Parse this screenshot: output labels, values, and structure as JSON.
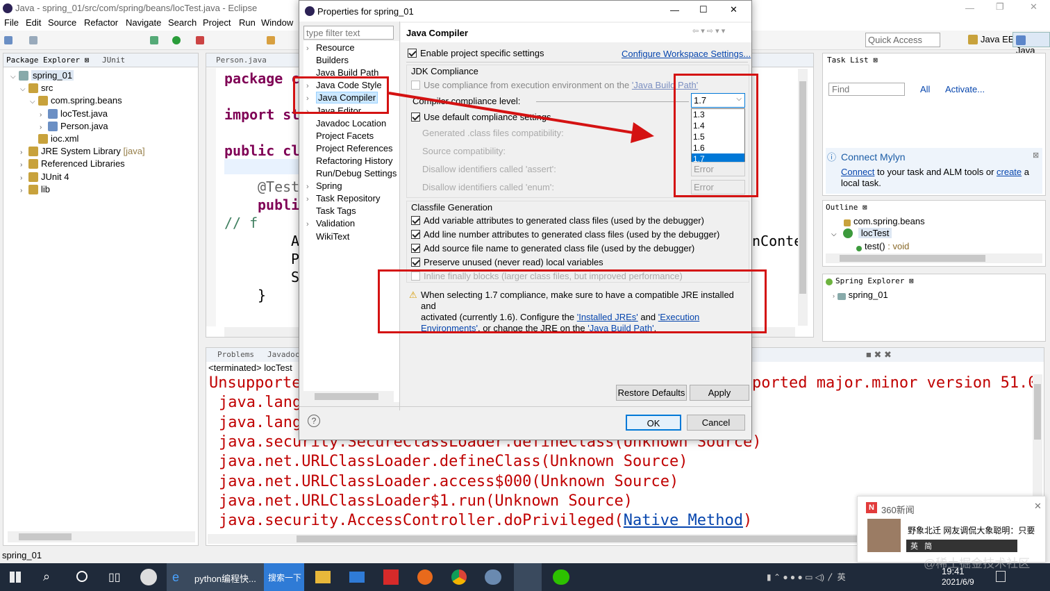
{
  "window_title": "Java - spring_01/src/com/spring/beans/locTest.java - Eclipse",
  "menu": [
    "File",
    "Edit",
    "Source",
    "Refactor",
    "Navigate",
    "Search",
    "Project",
    "Run",
    "Window"
  ],
  "quick_access_placeholder": "Quick Access",
  "perspectives": [
    "Java EE",
    "Java"
  ],
  "package_explorer": {
    "tab": "Package Explorer",
    "tab2": "JUnit",
    "tree": [
      {
        "label": "spring_01",
        "level": 0
      },
      {
        "label": "src",
        "level": 1
      },
      {
        "label": "com.spring.beans",
        "level": 2
      },
      {
        "label": "locTest.java",
        "level": 3
      },
      {
        "label": "Person.java",
        "level": 3
      },
      {
        "label": "ioc.xml",
        "level": 2
      },
      {
        "label": "JRE System Library",
        "suffix": "[java]",
        "level": 1
      },
      {
        "label": "Referenced Libraries",
        "level": 1
      },
      {
        "label": "JUnit 4",
        "level": 1
      },
      {
        "label": "lib",
        "level": 1
      }
    ]
  },
  "editor": {
    "tab": "Person.java",
    "lines": [
      "package c",
      "import st",
      "public cl",
      "@Test",
      "publi",
      "//       f",
      "A",
      "P",
      "S",
      "}"
    ],
    "right_fragment": "nConte"
  },
  "console": {
    "tabs": [
      "Problems",
      "Javadoc"
    ],
    "terminated": "<terminated> locTest",
    "lines": [
      "Unsupporte",
      "java.lang",
      "java.lang",
      "java.security.SecureClassLoader.defineClass(Unknown Source)",
      "java.net.URLClassLoader.defineClass(Unknown Source)",
      "java.net.URLClassLoader.access$000(Unknown Source)",
      "java.net.URLClassLoader$1.run(Unknown Source)"
    ],
    "last_line_prefix": "java.security.AccessController.doPrivileged(",
    "last_line_link": "Native Method",
    "last_line_suffix": ")",
    "right_fragment": "ported major.minor version 51.0"
  },
  "task_list": {
    "tab": "Task List",
    "find_placeholder": "Find",
    "all": "All",
    "activate": "Activate..."
  },
  "mylyn": {
    "title": "Connect Mylyn",
    "link1": "Connect",
    "text1": " to your task and ALM tools or ",
    "link2": "create",
    "text2": " a",
    "text3": "local task."
  },
  "outline": {
    "tab": "Outline",
    "package": "com.spring.beans",
    "class": "locTest",
    "method": "test()",
    "method_type": " : void"
  },
  "spring_explorer": {
    "tab": "Spring Explorer",
    "item": "spring_01"
  },
  "status_bar": "spring_01",
  "dialog": {
    "title": "Properties for spring_01",
    "filter_placeholder": "type filter text",
    "nav": [
      "Resource",
      "Builders",
      "Java Build Path",
      "Java Code Style",
      "Java Compiler",
      "Java Editor",
      "Javadoc Location",
      "Project Facets",
      "Project References",
      "Refactoring History",
      "Run/Debug Settings",
      "Spring",
      "Task Repository",
      "Task Tags",
      "Validation",
      "WikiText"
    ],
    "selected_nav": "Java Compiler",
    "page_title": "Java Compiler",
    "enable_specific": "Enable project specific settings",
    "configure_link": "Configure Workspace Settings...",
    "jdk_group": "JDK Compliance",
    "use_exec_env": "Use compliance from execution environment on the ",
    "java_build_path_link": "'Java Build Path'",
    "compliance_label": "Compiler compliance level:",
    "compliance_value": "1.7",
    "compliance_options": [
      "1.3",
      "1.4",
      "1.5",
      "1.6",
      "1.7"
    ],
    "use_default": "Use default compliance settings",
    "generated_label": "Generated .class files compatibility:",
    "source_label": "Source compatibility:",
    "assert_label": "Disallow identifiers called 'assert':",
    "assert_value": "Error",
    "enum_label": "Disallow identifiers called 'enum':",
    "enum_value": "Error",
    "classfile_group": "Classfile Generation",
    "classfile_opts": [
      "Add variable attributes to generated class files (used by the debugger)",
      "Add line number attributes to generated class files (used by the debugger)",
      "Add source file name to generated class file (used by the debugger)",
      "Preserve unused (never read) local variables"
    ],
    "inline_opt": "Inline finally blocks (larger class files, but improved performance)",
    "warning_1": "When selecting 1.7 compliance, make sure to have a compatible JRE installed and",
    "warning_2": "activated (currently 1.6). Configure the ",
    "installed_jres": "'Installed JREs'",
    "and": " and ",
    "exec_env_1": "'Execution",
    "exec_env_2": "Environments'",
    "warning_3": ", or change the JRE on the ",
    "build_path_link": "'Java Build Path'",
    "period": ".",
    "restore_defaults": "Restore Defaults",
    "apply": "Apply",
    "ok": "OK",
    "cancel": "Cancel"
  },
  "notification": {
    "source": "360新闻",
    "headline": "野象北迁 网友调侃大象聪明：只要",
    "icons": [
      "英",
      "简"
    ]
  },
  "taskbar": {
    "items": [
      "python编程快...",
      "搜索一下"
    ],
    "time": "19:41",
    "date": "2021/6/9",
    "watermark": "@稀土掘金技术社区"
  },
  "colors": {
    "accent_red": "#d41212",
    "selection": "#cce8ff",
    "console_red": "#c00000",
    "dropdown_blue": "#0078d7"
  }
}
